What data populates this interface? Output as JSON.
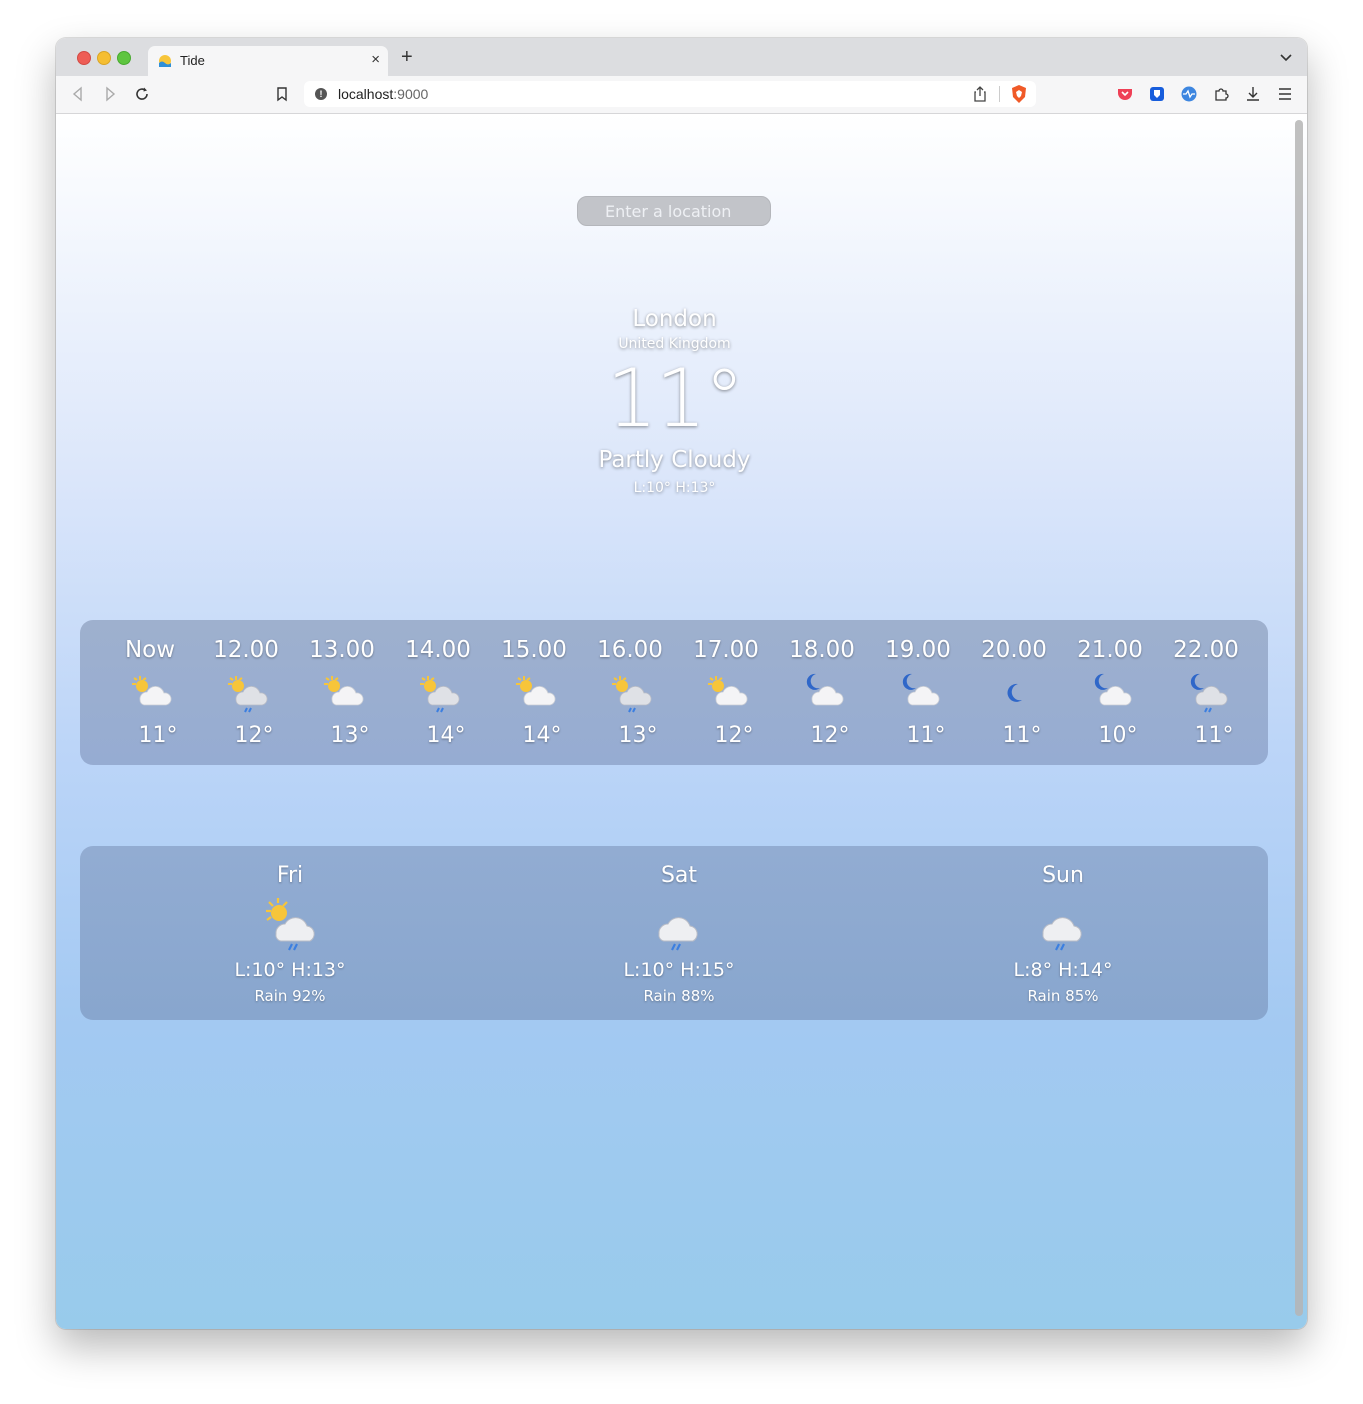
{
  "browser": {
    "tab_title": "Tide",
    "new_tab_symbol": "+",
    "close_symbol": "×",
    "url_host": "localhost",
    "url_port": ":9000"
  },
  "search": {
    "placeholder": "Enter a location"
  },
  "current": {
    "city": "London",
    "country": "United Kingdom",
    "temperature": "11°",
    "condition": "Partly Cloudy",
    "low_high": "L:10°  H:13°"
  },
  "hourly": [
    {
      "time": "Now",
      "icon": "sun-cloud-icon",
      "temp": "11°"
    },
    {
      "time": "12.00",
      "icon": "sun-cloud-rain-icon",
      "temp": "12°"
    },
    {
      "time": "13.00",
      "icon": "sun-cloud-icon",
      "temp": "13°"
    },
    {
      "time": "14.00",
      "icon": "sun-cloud-rain-icon",
      "temp": "14°"
    },
    {
      "time": "15.00",
      "icon": "sun-cloud-icon",
      "temp": "14°"
    },
    {
      "time": "16.00",
      "icon": "sun-cloud-rain-icon",
      "temp": "13°"
    },
    {
      "time": "17.00",
      "icon": "sun-cloud-icon",
      "temp": "12°"
    },
    {
      "time": "18.00",
      "icon": "moon-cloud-icon",
      "temp": "12°"
    },
    {
      "time": "19.00",
      "icon": "moon-cloud-icon",
      "temp": "11°"
    },
    {
      "time": "20.00",
      "icon": "moon-icon",
      "temp": "11°"
    },
    {
      "time": "21.00",
      "icon": "moon-cloud-icon",
      "temp": "10°"
    },
    {
      "time": "22.00",
      "icon": "moon-cloud-rain-icon",
      "temp": "11°"
    }
  ],
  "daily": [
    {
      "day": "Fri",
      "icon": "sun-cloud-rain-icon",
      "low_high": "L:10°  H:13°",
      "rain": "Rain 92%"
    },
    {
      "day": "Sat",
      "icon": "cloud-rain-icon",
      "low_high": "L:10°  H:15°",
      "rain": "Rain 88%"
    },
    {
      "day": "Sun",
      "icon": "cloud-rain-icon",
      "low_high": "L:8°  H:14°",
      "rain": "Rain 85%"
    }
  ],
  "colors": {
    "sun": "#f7c53a",
    "cloud": "#f4f4f6",
    "moon": "#2f67c9",
    "rain": "#3c7fe0"
  }
}
